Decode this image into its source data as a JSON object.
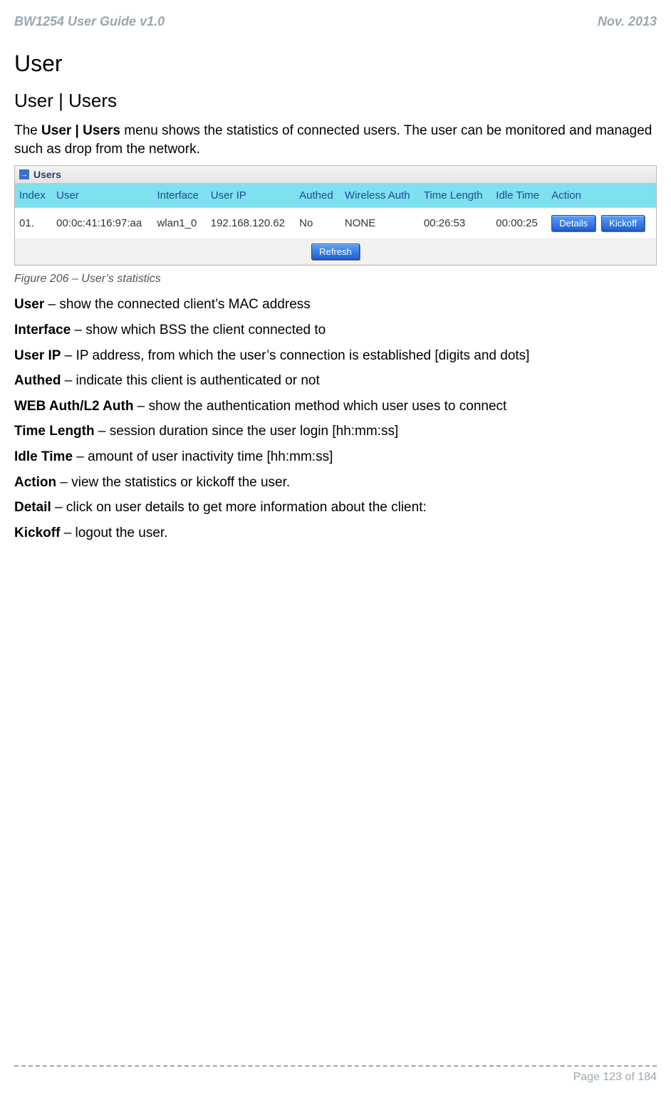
{
  "header": {
    "left": "BW1254 User Guide v1.0",
    "right": "Nov.  2013"
  },
  "titles": {
    "h1": "User",
    "h2": "User | Users"
  },
  "intro": {
    "pre": "The ",
    "bold": "User | Users",
    "post": " menu shows the statistics of connected users. The user can be monitored and managed such as drop from the network."
  },
  "shot": {
    "panel_title": "Users",
    "headers": [
      "Index",
      "User",
      "Interface",
      "User IP",
      "Authed",
      "Wireless Auth",
      "Time Length",
      "Idle Time",
      "Action"
    ],
    "row": {
      "index": "01.",
      "user": "00:0c:41:16:97:aa",
      "interface": "wlan1_0",
      "ip": "192.168.120.62",
      "authed": "No",
      "wauth": "NONE",
      "time_length": "00:26:53",
      "idle": "00:00:25",
      "btn_details": "Details",
      "btn_kickoff": "Kickoff"
    },
    "refresh": "Refresh"
  },
  "caption": "Figure 206 – User’s statistics",
  "defs": [
    {
      "term": "User",
      "text": " – show the connected client’s MAC address"
    },
    {
      "term": "Interface",
      "text": " – show which BSS the client connected to"
    },
    {
      "term": "User IP",
      "text": " – IP address, from which the user’s connection is established [digits and dots]"
    },
    {
      "term": "Authed",
      "text": " – indicate this client is authenticated or not"
    },
    {
      "term": "WEB Auth/L2 Auth",
      "text": " – show the authentication method which user uses to connect"
    },
    {
      "term": "Time Length",
      "text": " – session duration since the user login [hh:mm:ss]"
    },
    {
      "term": "Idle Time",
      "text": " – amount of user inactivity time [hh:mm:ss]"
    },
    {
      "term": "Action",
      "text": " – view the statistics or kickoff the user."
    },
    {
      "term": "Detail",
      "text": " – click on user details to get more information about the client:"
    },
    {
      "term": "Kickoff",
      "text": " – logout the user."
    }
  ],
  "footer": {
    "page": "Page 123 of 184"
  }
}
